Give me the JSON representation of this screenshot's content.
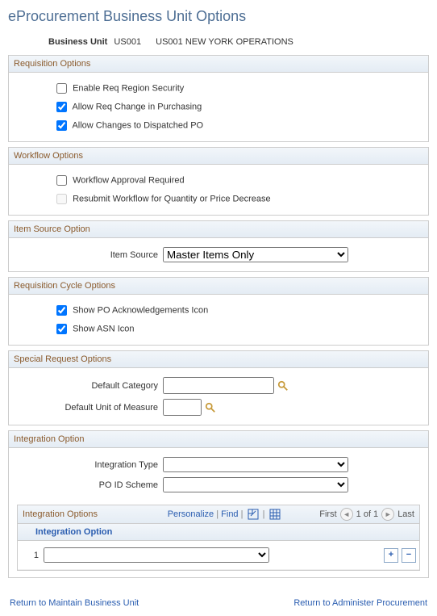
{
  "page_title": "eProcurement Business Unit Options",
  "bu": {
    "label": "Business Unit",
    "code": "US001",
    "desc": "US001 NEW YORK OPERATIONS"
  },
  "req_options": {
    "header": "Requisition Options",
    "enable_region": {
      "label": "Enable Req Region Security",
      "checked": false
    },
    "allow_change": {
      "label": "Allow Req Change in Purchasing",
      "checked": true
    },
    "allow_dispatch": {
      "label": "Allow Changes to Dispatched PO",
      "checked": true
    }
  },
  "workflow": {
    "header": "Workflow Options",
    "approval": {
      "label": "Workflow Approval Required",
      "checked": false
    },
    "resubmit": {
      "label": "Resubmit Workflow for Quantity or Price Decrease",
      "checked": false,
      "disabled": true
    }
  },
  "item_source": {
    "header": "Item Source Option",
    "label": "Item Source",
    "value": "Master Items Only"
  },
  "cycle": {
    "header": "Requisition Cycle Options",
    "po_ack": {
      "label": "Show PO Acknowledgements Icon",
      "checked": true
    },
    "asn": {
      "label": "Show ASN Icon",
      "checked": true
    }
  },
  "special": {
    "header": "Special Request Options",
    "category": {
      "label": "Default Category",
      "value": ""
    },
    "uom": {
      "label": "Default Unit of Measure",
      "value": ""
    }
  },
  "integration": {
    "header": "Integration Option",
    "type": {
      "label": "Integration Type",
      "value": ""
    },
    "scheme": {
      "label": "PO ID Scheme",
      "value": ""
    },
    "grid": {
      "title": "Integration Options",
      "personalize": "Personalize",
      "find": "Find",
      "first": "First",
      "counter": "1 of 1",
      "last": "Last",
      "col_header": "Integration Option",
      "rows": [
        {
          "num": "1",
          "value": ""
        }
      ]
    }
  },
  "footer": {
    "left": "Return to Maintain Business Unit",
    "right": "Return to Administer Procurement"
  }
}
